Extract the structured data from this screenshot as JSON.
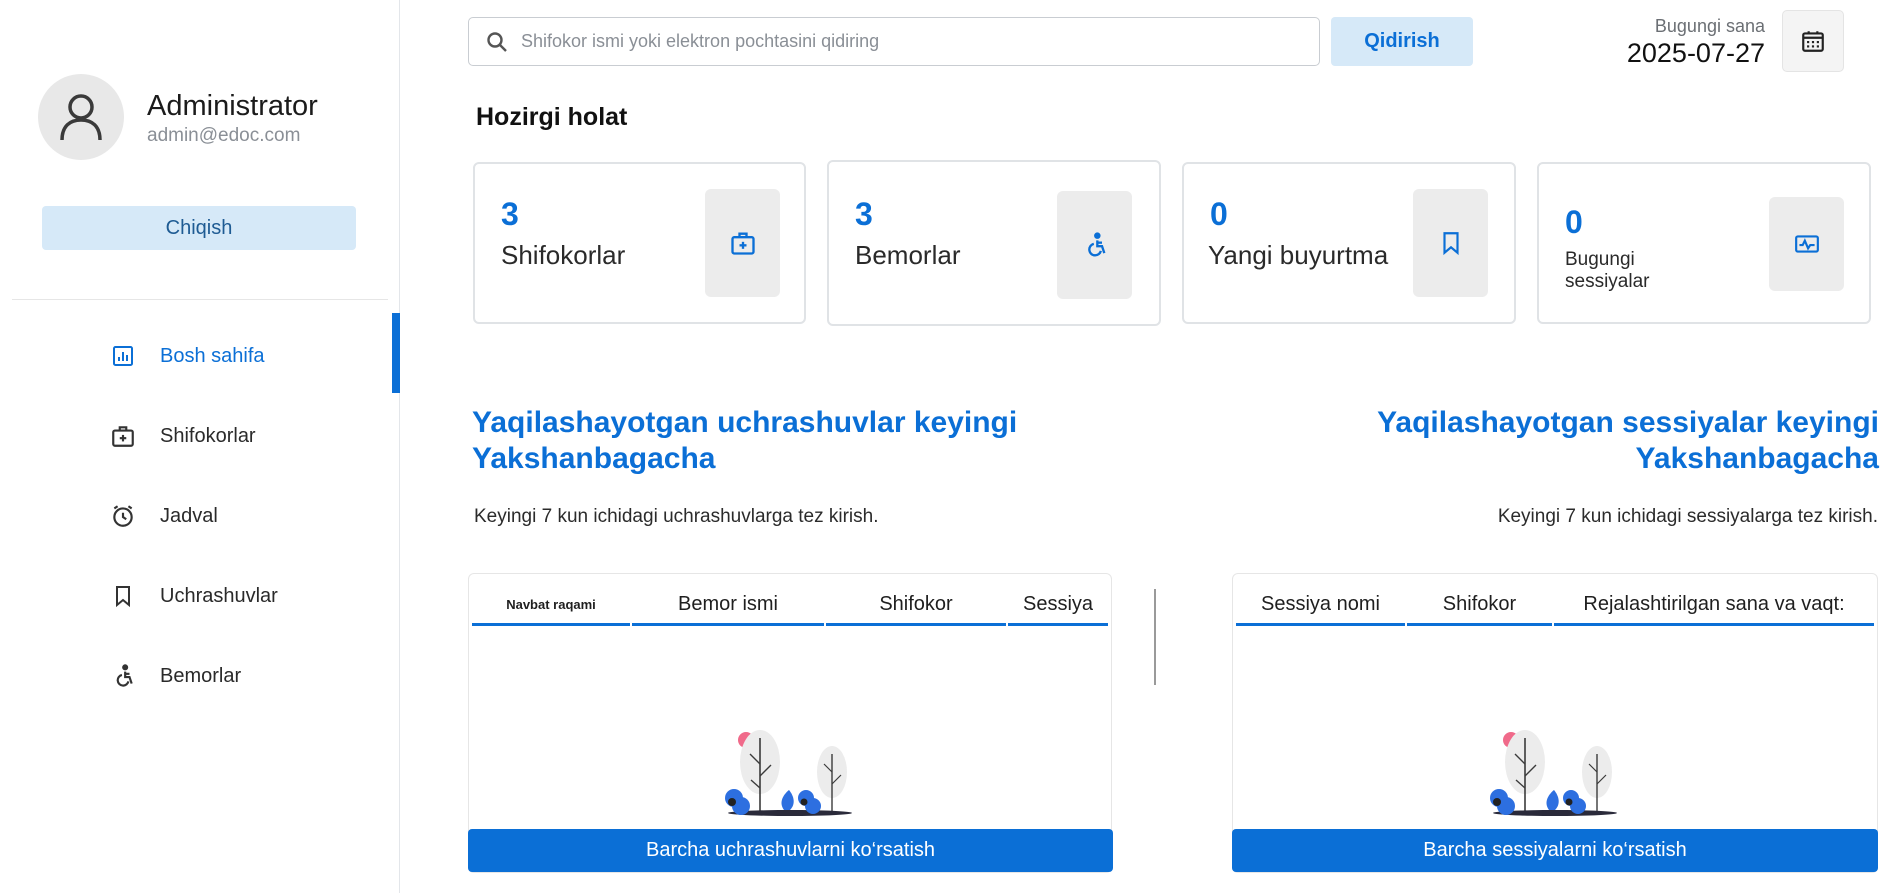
{
  "sidebar": {
    "admin_name": "Administrator",
    "admin_email": "admin@edoc.com",
    "logout_label": "Chiqish",
    "items": [
      {
        "label": "Bosh sahifa",
        "icon": "bar-chart-icon",
        "active": true
      },
      {
        "label": "Shifokorlar",
        "icon": "medical-case-icon",
        "active": false
      },
      {
        "label": "Jadval",
        "icon": "alarm-clock-icon",
        "active": false
      },
      {
        "label": "Uchrashuvlar",
        "icon": "bookmark-icon",
        "active": false
      },
      {
        "label": "Bemorlar",
        "icon": "accessible-icon",
        "active": false
      }
    ]
  },
  "header": {
    "search_placeholder": "Shifokor ismi yoki elektron pochtasini qidiring",
    "search_button": "Qidirish",
    "date_label": "Bugungi sana",
    "date_value": "2025-07-27"
  },
  "status": {
    "title": "Hozirgi holat",
    "cards": [
      {
        "value": "3",
        "label": "Shifokorlar",
        "icon": "medical-case-icon"
      },
      {
        "value": "3",
        "label": "Bemorlar",
        "icon": "accessible-icon"
      },
      {
        "value": "0",
        "label": "Yangi buyurtma",
        "icon": "bookmark-icon"
      },
      {
        "value": "0",
        "label": "Bugungi sessiyalar",
        "icon": "pulse-chart-icon"
      }
    ]
  },
  "appointments": {
    "heading": "Yaqilashayotgan uchrashuvlar keyingi Yakshanbagacha",
    "subtext": "Keyingi 7 kun ichidagi uchrashuvlarga tez kirish.",
    "columns": [
      "Navbat raqami",
      "Bemor ismi",
      "Shifokor",
      "Sessiya"
    ],
    "button": "Barcha uchrashuvlarni ko‘rsatish"
  },
  "sessions": {
    "heading": "Yaqilashayotgan sessiyalar keyingi Yakshanbagacha",
    "subtext": "Keyingi 7 kun ichidagi sessiyalarga tez kirish.",
    "columns": [
      "Sessiya nomi",
      "Shifokor",
      "Rejalashtirilgan sana va vaqt:"
    ],
    "button": "Barcha sessiyalarni ko‘rsatish"
  },
  "colors": {
    "accent": "#0b6fd6",
    "light_accent": "#d6e9f8",
    "illustration_pink": "#f06a8a",
    "illustration_blue": "#2d6fe0"
  }
}
